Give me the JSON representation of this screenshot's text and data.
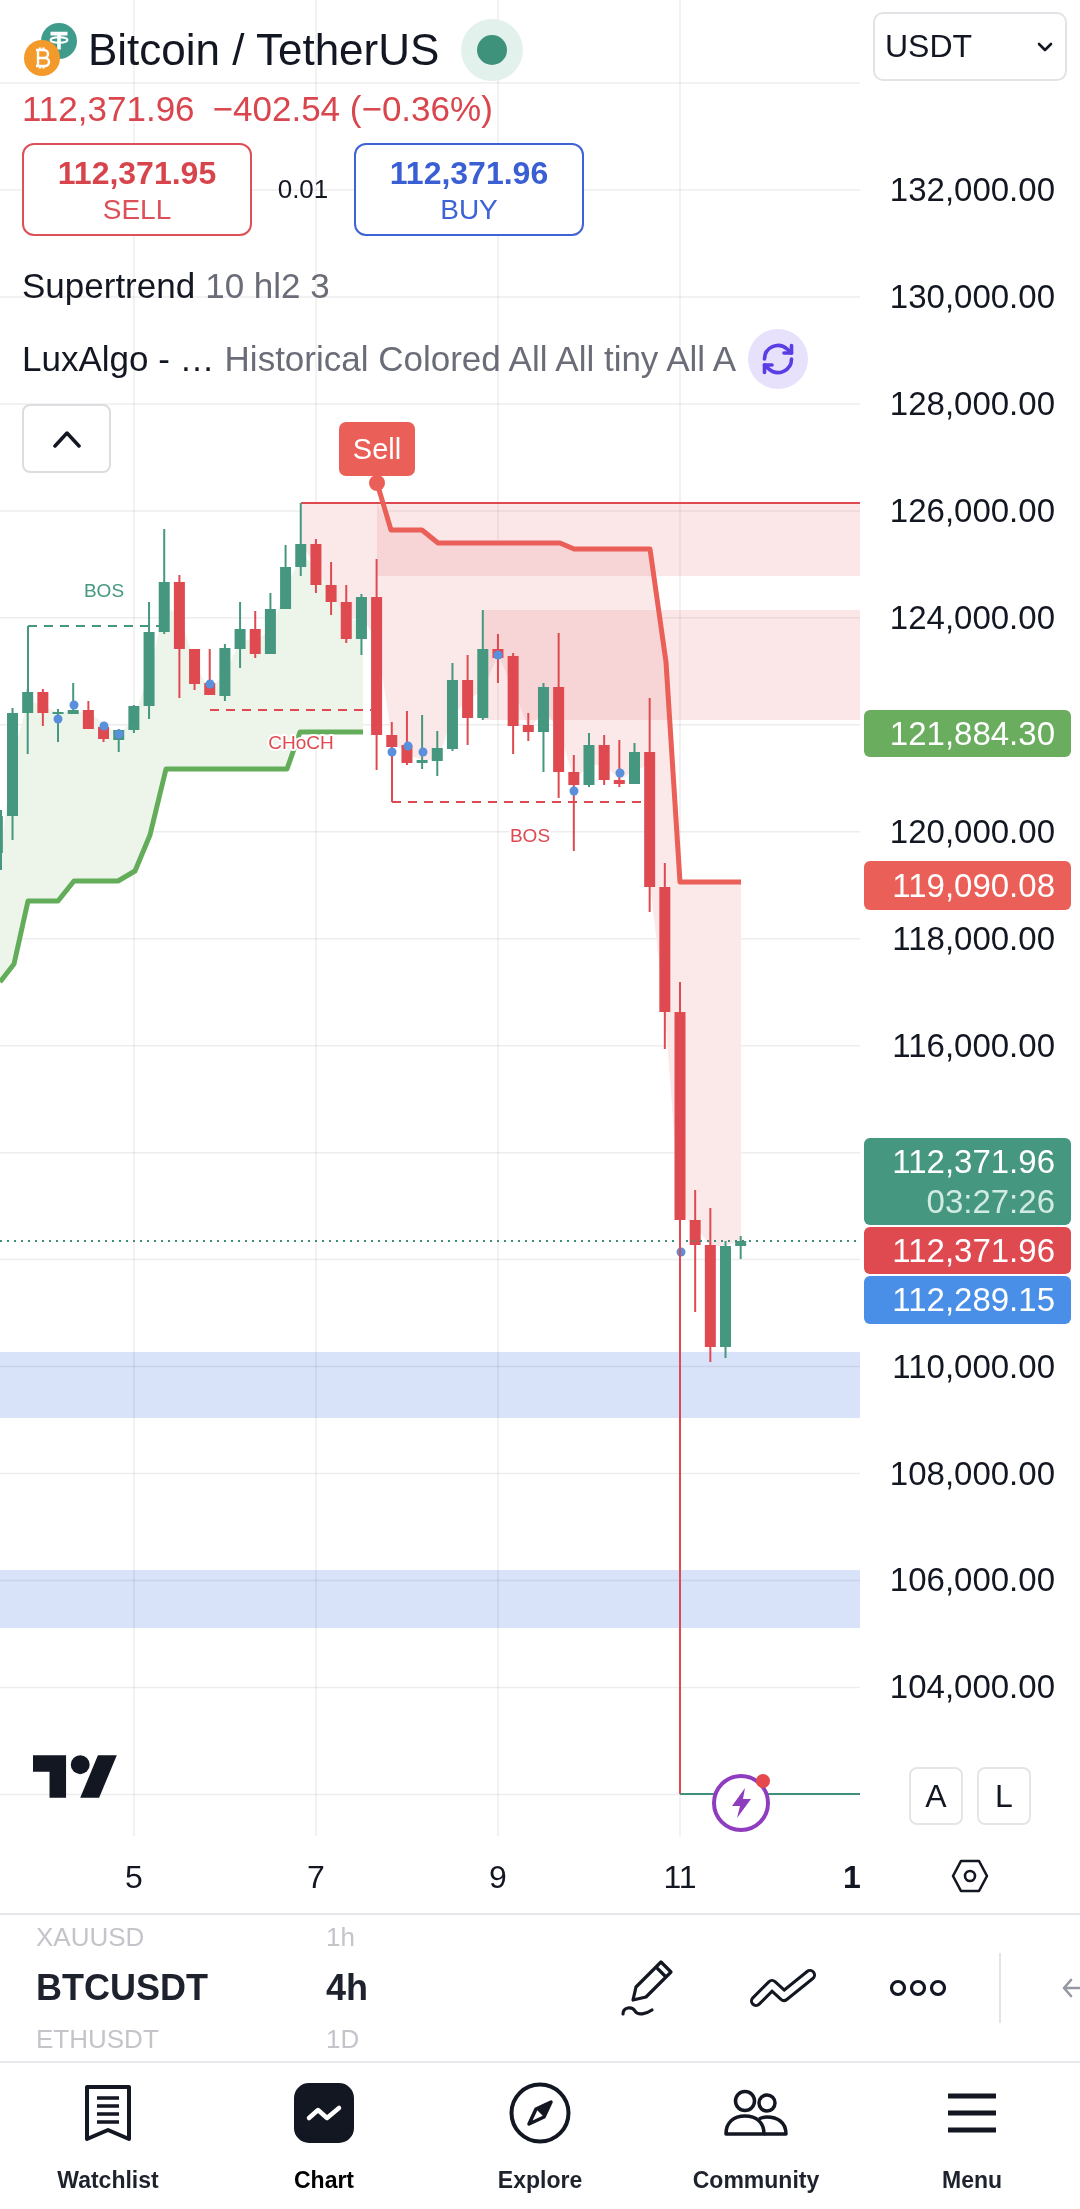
{
  "header": {
    "title": "Bitcoin / TetherUS",
    "market_open": true,
    "currency": "USDT",
    "price": "112,371.96",
    "change": "−402.54 (−0.36%)",
    "price_falling": true
  },
  "trade": {
    "sell_price": "112,371.95",
    "sell_label": "SELL",
    "spread": "0.01",
    "buy_price": "112,371.96",
    "buy_label": "BUY"
  },
  "legend": {
    "expanded": true,
    "items": [
      {
        "name": "Supertrend",
        "params": "10 hl2 3",
        "loading": false
      },
      {
        "name": "LuxAlgo - …",
        "params": "Historical Colored All All tiny All A",
        "loading": true
      }
    ]
  },
  "chart": {
    "signal_label": "Sell",
    "structure_labels": [
      {
        "text": "BOS",
        "kind": "bullish"
      },
      {
        "text": "CHoCH",
        "kind": "bearish"
      },
      {
        "text": "BOS",
        "kind": "bearish"
      }
    ]
  },
  "price_axis": {
    "ticks": [
      "132,000.00",
      "130,000.00",
      "128,000.00",
      "126,000.00",
      "124,000.00",
      "120,000.00",
      "118,000.00",
      "116,000.00",
      "110,000.00",
      "108,000.00",
      "106,000.00",
      "104,000.00"
    ],
    "tags": [
      {
        "label": "121,884.30",
        "color": "#6aad5e"
      },
      {
        "label": "119,090.08",
        "color": "#ea5f58"
      },
      {
        "label": "112,371.96",
        "countdown": "03:27:26",
        "color": "#45977f"
      },
      {
        "label": "112,371.96",
        "color": "#df4a51"
      },
      {
        "label": "112,289.15",
        "color": "#4a8fe7"
      }
    ]
  },
  "scale_buttons": [
    "A",
    "L"
  ],
  "time_axis": [
    {
      "label": "5",
      "major": false
    },
    {
      "label": "7",
      "major": false
    },
    {
      "label": "9",
      "major": false
    },
    {
      "label": "11",
      "major": false
    },
    {
      "label": "1",
      "major": true
    }
  ],
  "symbol_picker": [
    {
      "symbol": "XAUUSD",
      "interval": "1h",
      "selected": false
    },
    {
      "symbol": "BTCUSDT",
      "interval": "4h",
      "selected": true
    },
    {
      "symbol": "ETHUSDT",
      "interval": "1D",
      "selected": false
    }
  ],
  "bottom_nav": [
    {
      "label": "Watchlist",
      "selected": false
    },
    {
      "label": "Chart",
      "selected": true
    },
    {
      "label": "Explore",
      "selected": false
    },
    {
      "label": "Community",
      "selected": false
    },
    {
      "label": "Menu",
      "selected": false
    }
  ]
}
